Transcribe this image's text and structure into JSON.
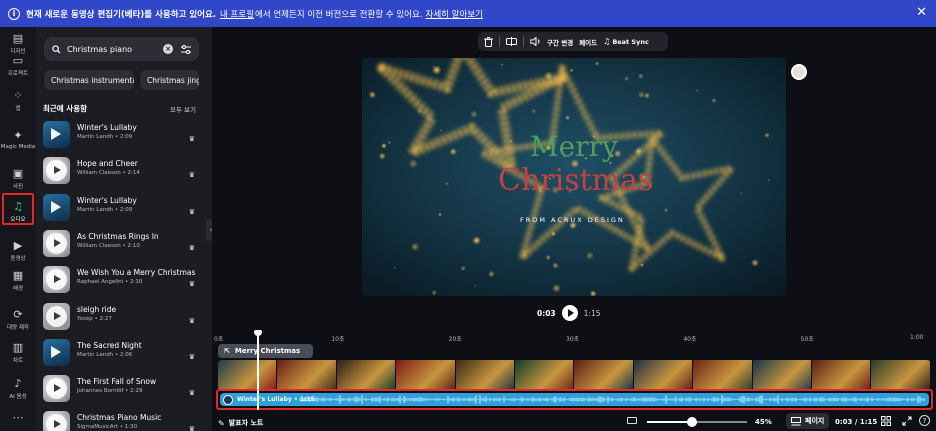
{
  "banner": {
    "bold_text": "현재 새로운 동영상 편집기(베타)를 사용하고 있어요.",
    "link1": "내 프로필",
    "middle_text": "에서 언제든지 이전 버전으로 전환할 수 있어요.",
    "link2": "자세히 알아보기",
    "close": "✕",
    "color": "#2f47c8"
  },
  "rail": {
    "items": [
      {
        "id": "design",
        "label": "디자인",
        "icon": "design-icon"
      },
      {
        "id": "projects",
        "label": "프로젝트",
        "icon": "folder-icon"
      },
      {
        "id": "apps",
        "label": "앱",
        "icon": "apps-icon"
      },
      {
        "id": "magic-media",
        "label": "Magic Media",
        "icon": "magic-media-icon"
      },
      {
        "id": "photos",
        "label": "사진",
        "icon": "photo-icon"
      },
      {
        "id": "audio",
        "label": "오디오",
        "icon": "music-note-icon",
        "active": true
      },
      {
        "id": "video",
        "label": "동영상",
        "icon": "video-icon"
      },
      {
        "id": "background",
        "label": "배경",
        "icon": "background-icon"
      },
      {
        "id": "bulk-create",
        "label": "대량 제작",
        "icon": "bulk-create-icon"
      },
      {
        "id": "charts",
        "label": "차트",
        "icon": "chart-icon"
      },
      {
        "id": "ai-voice",
        "label": "AI 음성",
        "icon": "ai-voice-icon"
      },
      {
        "id": "more",
        "label": "",
        "icon": "more-icon"
      }
    ],
    "active_color": "#e0282b"
  },
  "panel": {
    "search": {
      "value": "Christmas piano"
    },
    "chips": [
      "Christmas instrumental",
      "Christmas jingle"
    ],
    "recent_title": "최근에 사용함",
    "see_all": "모두 보기",
    "tracks": [
      {
        "title": "Winter's Lullaby",
        "artist": "Martin Landh • 2:09",
        "thumb": "snowglobe"
      },
      {
        "title": "Hope and Cheer",
        "artist": "William Claeson • 2:14",
        "thumb": "ornament"
      },
      {
        "title": "Winter's Lullaby",
        "artist": "Martin Landh • 2:09",
        "thumb": "snowglobe"
      },
      {
        "title": "As Christmas Rings In",
        "artist": "William Claeson • 2:10",
        "thumb": "ornament"
      },
      {
        "title": "We Wish You a Merry Christmas",
        "artist": "Raphael Angelini • 2:10",
        "thumb": "ornament"
      },
      {
        "title": "sleigh ride",
        "artist": "Yosep • 2:27",
        "thumb": "grey"
      },
      {
        "title": "The Sacred Night",
        "artist": "Martin Landh • 2:06",
        "thumb": "snowglobe"
      },
      {
        "title": "The First Fall of Snow",
        "artist": "Johannes Bornlöf • 2:29",
        "thumb": "ornament"
      },
      {
        "title": "Christmas Piano Music",
        "artist": "SigmaMusicArt • 1:30",
        "thumb": "ornament"
      }
    ]
  },
  "toolbar": {
    "split": "구간 변경",
    "fade": "페이드",
    "beat_sync": "Beat Sync"
  },
  "canvas": {
    "title_line1": "Merry",
    "title_line2": "Christmas",
    "subtitle": "FROM ACRUX DESIGN",
    "title1_color": "#4f9e5c",
    "title2_color": "#c8403d"
  },
  "player": {
    "current": "0:03",
    "total": "1:15"
  },
  "timeline": {
    "ruler": [
      "0초",
      "10초",
      "20초",
      "30초",
      "40초",
      "50초",
      "1:00"
    ],
    "text_clip": "Merry Christmas",
    "audio_clip": "Winter's Lullaby • 1:15",
    "audio_color": "#2ba0d9"
  },
  "status": {
    "notes": "발표자 노트",
    "zoom_value": 0.45,
    "zoom_label": "45%",
    "pages": "페이지",
    "time": "0:03 / 1:15",
    "help": "?"
  }
}
